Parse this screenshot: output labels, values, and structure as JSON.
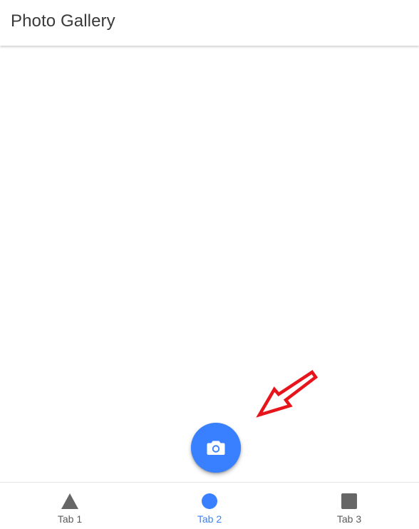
{
  "header": {
    "title": "Photo Gallery"
  },
  "fab": {
    "icon": "camera-icon",
    "color": "#3880ff"
  },
  "annotation": {
    "icon": "arrow-icon",
    "color": "#e8141c"
  },
  "tabs": [
    {
      "label": "Tab 1",
      "icon": "triangle-icon",
      "active": false
    },
    {
      "label": "Tab 2",
      "icon": "ellipse-icon",
      "active": true
    },
    {
      "label": "Tab 3",
      "icon": "square-icon",
      "active": false
    }
  ],
  "colors": {
    "accent": "#3880ff",
    "inactive": "#666666",
    "text": "#3a3a3a"
  }
}
